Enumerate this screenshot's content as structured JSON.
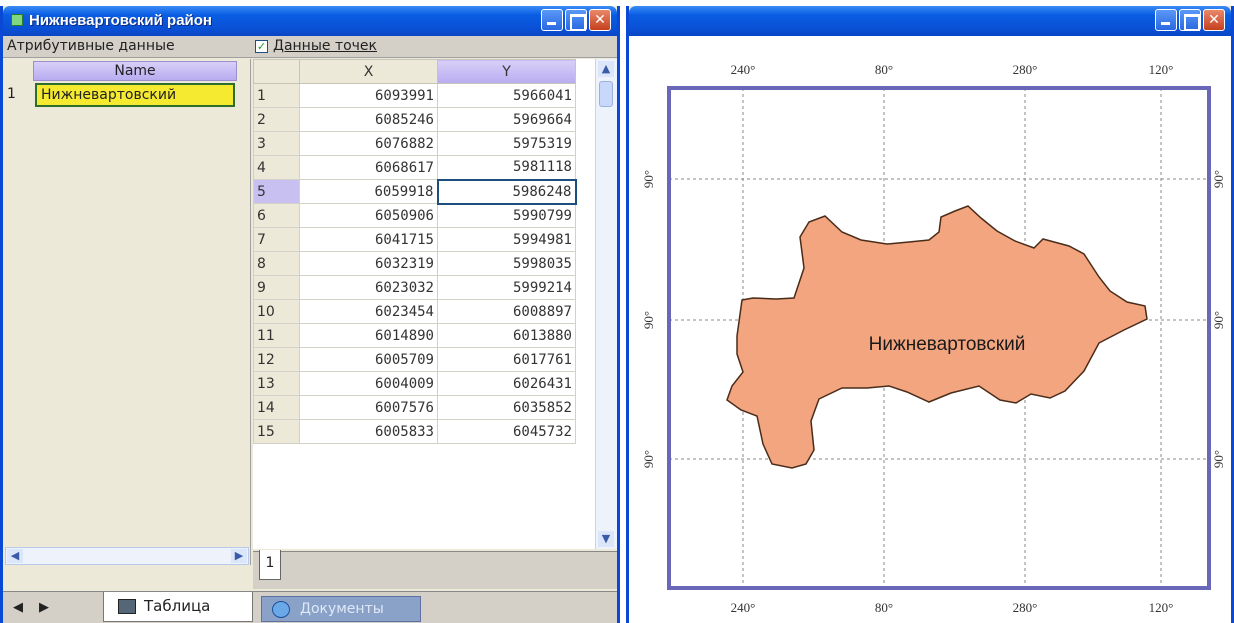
{
  "left_window": {
    "title": "Нижневартовский район",
    "attr_label": "Атрибутивные данные",
    "points_label": "Данные точек",
    "points_checked": "✓",
    "attr_table": {
      "header": "Name",
      "row_number": "1",
      "row_value": "Нижневартовский"
    },
    "grid": {
      "headers": [
        "X",
        "Y"
      ],
      "selected_row": 5,
      "rows": [
        {
          "n": "1",
          "x": "6093991",
          "y": "5966041"
        },
        {
          "n": "2",
          "x": "6085246",
          "y": "5969664"
        },
        {
          "n": "3",
          "x": "6076882",
          "y": "5975319"
        },
        {
          "n": "4",
          "x": "6068617",
          "y": "5981118"
        },
        {
          "n": "5",
          "x": "6059918",
          "y": "5986248"
        },
        {
          "n": "6",
          "x": "6050906",
          "y": "5990799"
        },
        {
          "n": "7",
          "x": "6041715",
          "y": "5994981"
        },
        {
          "n": "8",
          "x": "6032319",
          "y": "5998035"
        },
        {
          "n": "9",
          "x": "6023032",
          "y": "5999214"
        },
        {
          "n": "10",
          "x": "6023454",
          "y": "6008897"
        },
        {
          "n": "11",
          "x": "6014890",
          "y": "6013880"
        },
        {
          "n": "12",
          "x": "6005709",
          "y": "6017761"
        },
        {
          "n": "13",
          "x": "6004009",
          "y": "6026431"
        },
        {
          "n": "14",
          "x": "6007576",
          "y": "6035852"
        },
        {
          "n": "15",
          "x": "6005833",
          "y": "6045732"
        }
      ]
    },
    "sheet_tab": "1",
    "tabs": {
      "table": "Таблица",
      "documents": "Документы"
    }
  },
  "map_window": {
    "top_labels": [
      "240°",
      "80°",
      "280°",
      "120°"
    ],
    "bottom_labels": [
      "240°",
      "80°",
      "280°",
      "120°"
    ],
    "side_labels": [
      "90°",
      "90°",
      "90°"
    ],
    "region_label": "Нижневартовский",
    "region_fill": "#f3a57f",
    "frame_color": "#6a66b8"
  },
  "icons": {
    "minimize": "minimize-icon",
    "maximize": "maximize-icon",
    "close": "close-icon",
    "scroll_up": "▲",
    "scroll_down": "▼",
    "scroll_left": "◀",
    "scroll_right": "▶",
    "nav_prev": "◀",
    "nav_next": "▶",
    "close_glyph": "✕"
  }
}
